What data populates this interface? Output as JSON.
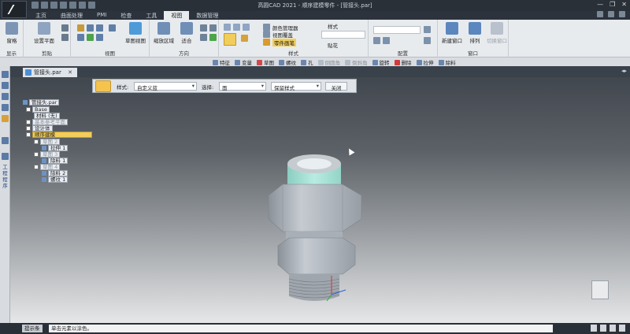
{
  "window": {
    "title": "高圆CAD 2021 - 顺序建模零件 - [管接头.par]",
    "controls": [
      "—",
      "❐",
      "✕"
    ]
  },
  "menu": {
    "tabs": [
      "主页",
      "曲面处理",
      "PMI",
      "检查",
      "工具",
      "视图",
      "数据管理"
    ],
    "active_index": 5
  },
  "ribbon": {
    "groups": {
      "show": {
        "label": "显示",
        "button": "窗格"
      },
      "notes": {
        "label": "剪贴",
        "button": "设置平面"
      },
      "view": {
        "label": "视图",
        "button": "草图视图"
      },
      "orient": {
        "label": "方向",
        "button1": "缩放区域",
        "button2": "适合"
      },
      "style": {
        "label": "样式",
        "items": [
          "颜色管理器",
          "视图覆盖",
          "零件画笔"
        ],
        "item2": "样式",
        "item3": "贴花",
        "dropdown": ""
      },
      "config": {
        "label": "配置",
        "input": ""
      },
      "window": {
        "label": "窗口",
        "button1": "新建窗口",
        "button2": "排列",
        "button3": "切换窗口"
      }
    }
  },
  "command_bar": {
    "items": [
      "特征",
      "变量",
      "草图",
      "螺纹",
      "孔",
      "倒圆角",
      "倒斜角",
      "旋转",
      "删除",
      "拉伸",
      "除料"
    ]
  },
  "document": {
    "tab_label": "管接头.par",
    "close": "✕"
  },
  "viewport_toolbar": {
    "label_style": "样式:",
    "style_value": "自定义蓝",
    "label_select": "选择:",
    "select_value": "面",
    "option_value": "保留样式",
    "close_button": "关闭"
  },
  "tree": [
    {
      "label": "管接头.par",
      "level": 0
    },
    {
      "label": "Base",
      "level": 1
    },
    {
      "label": "材料 (无)",
      "level": 1
    },
    {
      "label": "基本参考平面",
      "level": 1
    },
    {
      "label": "设计体",
      "level": 1
    },
    {
      "label": "顺序建模",
      "level": 1,
      "selected": true
    },
    {
      "label": "草图 2",
      "level": 2
    },
    {
      "label": "拉伸 1",
      "level": 2
    },
    {
      "label": "草图 3",
      "level": 2
    },
    {
      "label": "除料 1",
      "level": 2
    },
    {
      "label": "草图 4",
      "level": 2
    },
    {
      "label": "除料 2",
      "level": 2
    },
    {
      "label": "螺纹 1",
      "level": 2
    }
  ],
  "left_panel": {
    "vertical_label": "工程程序"
  },
  "status": {
    "label": "提示条",
    "message": "单击元素以涂色。"
  },
  "colors": {
    "accent": "#f1cd5b",
    "part_body": "#a9b0b9",
    "part_face_highlight": "#a8e1d6"
  },
  "icons": [
    "search-icon",
    "cube-icon",
    "zoom-icon",
    "palette-icon",
    "window-icon"
  ]
}
